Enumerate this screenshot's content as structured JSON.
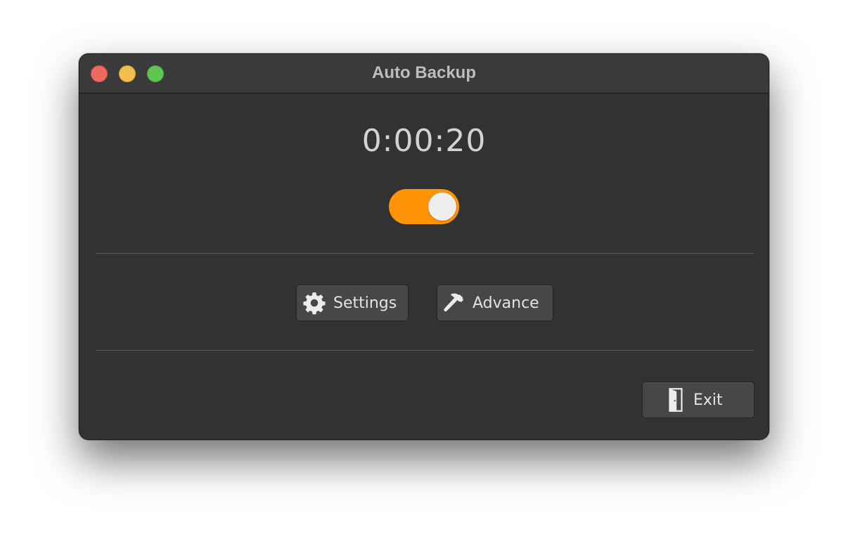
{
  "window": {
    "title": "Auto Backup"
  },
  "timer": {
    "value": "0:00:20"
  },
  "toggle": {
    "on": true,
    "accent_color": "#ff9408"
  },
  "buttons": {
    "settings": {
      "label": "Settings",
      "icon": "gear-icon"
    },
    "advance": {
      "label": "Advance",
      "icon": "hammer-icon"
    },
    "exit": {
      "label": "Exit",
      "icon": "door-icon"
    }
  }
}
